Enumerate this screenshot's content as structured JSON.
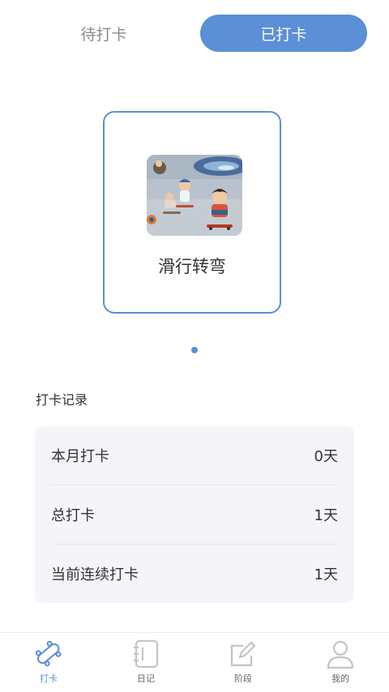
{
  "tabs": {
    "pending": "待打卡",
    "done": "已打卡"
  },
  "card": {
    "title": "滑行转弯",
    "image_icon": "skateboard-kids-illustration"
  },
  "records": {
    "title": "打卡记录",
    "rows": [
      {
        "label": "本月打卡",
        "value": "0天"
      },
      {
        "label": "总打卡",
        "value": "1天"
      },
      {
        "label": "当前连续打卡",
        "value": "1天"
      }
    ]
  },
  "nav": [
    {
      "label": "打卡",
      "icon": "skateboard-icon",
      "active": true
    },
    {
      "label": "日记",
      "icon": "notebook-icon"
    },
    {
      "label": "阶段",
      "icon": "edit-icon"
    },
    {
      "label": "我的",
      "icon": "user-icon"
    }
  ],
  "colors": {
    "accent": "#5b8fd6",
    "panel": "#f5f5f9"
  }
}
